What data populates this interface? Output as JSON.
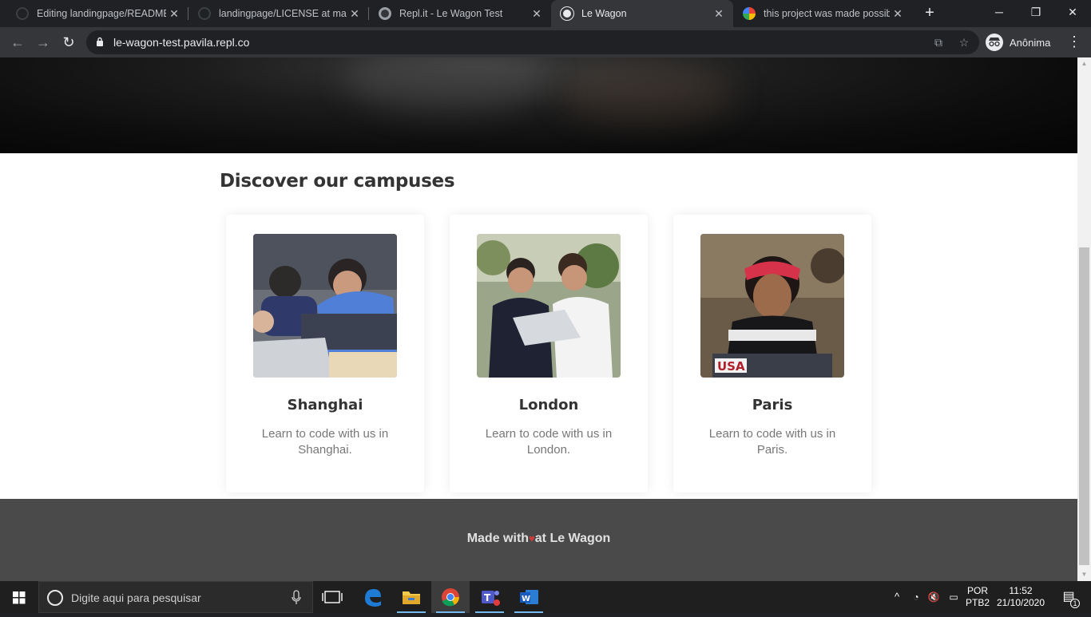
{
  "browser": {
    "tabs": [
      {
        "title": "Editing landingpage/README.",
        "active": false,
        "favicon": "github-icon"
      },
      {
        "title": "landingpage/LICENSE at main",
        "active": false,
        "favicon": "github-icon"
      },
      {
        "title": "Repl.it - Le Wagon Test",
        "active": false,
        "favicon": "replit-icon"
      },
      {
        "title": "Le Wagon",
        "active": true,
        "favicon": "globe-icon"
      },
      {
        "title": "this project was made possible",
        "active": false,
        "favicon": "google-icon"
      }
    ],
    "url": "le-wagon-test.pavila.repl.co",
    "profile_label": "Anônima"
  },
  "page": {
    "section_title": "Discover our campuses",
    "campuses": [
      {
        "city": "Shanghai",
        "description": "Learn to code with us in Shanghai."
      },
      {
        "city": "London",
        "description": "Learn to code with us in London."
      },
      {
        "city": "Paris",
        "description": "Learn to code with us in Paris."
      }
    ],
    "footer": {
      "made_with": "Made with",
      "heart": "♥",
      "at": "at Le Wagon"
    }
  },
  "taskbar": {
    "search_placeholder": "Digite aqui para pesquisar",
    "language": "POR",
    "layout": "PTB2",
    "time": "11:52",
    "date": "21/10/2020",
    "notification_count": "1"
  },
  "colors": {
    "accent_running": "#76b9ed",
    "footer_bg": "#4a4a4a",
    "heart": "#d23a3a"
  }
}
